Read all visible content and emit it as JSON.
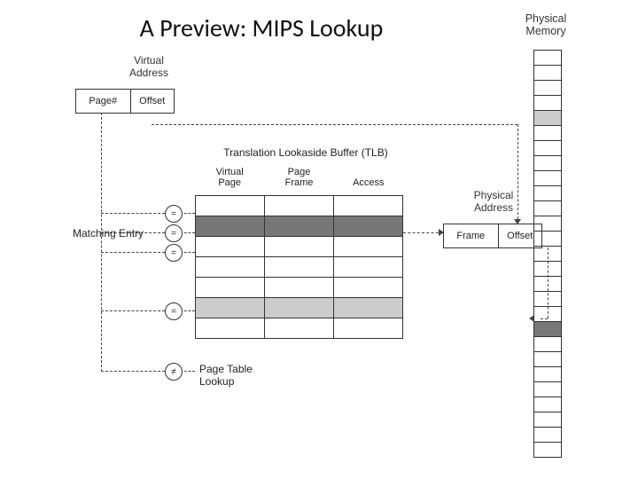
{
  "title": "A Preview: MIPS Lookup",
  "virtual_address": {
    "label_line1": "Virtual",
    "label_line2": "Address",
    "page_col": "Page#",
    "offset_col": "Offset"
  },
  "tlb": {
    "title": "Translation Lookaside Buffer (TLB)",
    "cols": {
      "vp_line1": "Virtual",
      "vp_line2": "Page",
      "pf_line1": "Page",
      "pf_line2": "Frame",
      "access": "Access"
    },
    "rows": [
      {
        "shade": "none"
      },
      {
        "shade": "dark"
      },
      {
        "shade": "none"
      },
      {
        "shade": "none"
      },
      {
        "shade": "none"
      },
      {
        "shade": "light"
      },
      {
        "shade": "none"
      }
    ]
  },
  "comparators": [
    "=",
    "=",
    "=",
    "=",
    "≠"
  ],
  "matching_entry_label": "Matching Entry",
  "page_table_lookup": {
    "line1": "Page Table",
    "line2": "Lookup"
  },
  "physical_address": {
    "label_line1": "Physical",
    "label_line2": "Address",
    "frame_col": "Frame",
    "offset_col": "Offset"
  },
  "physical_memory": {
    "label_line1": "Physical",
    "label_line2": "Memory",
    "cells": [
      "none",
      "none",
      "none",
      "none",
      "light",
      "none",
      "none",
      "none",
      "none",
      "none",
      "none",
      "none",
      "none",
      "none",
      "none",
      "none",
      "none",
      "none",
      "dark",
      "none",
      "none",
      "none",
      "none",
      "none",
      "none",
      "none",
      "none"
    ]
  }
}
